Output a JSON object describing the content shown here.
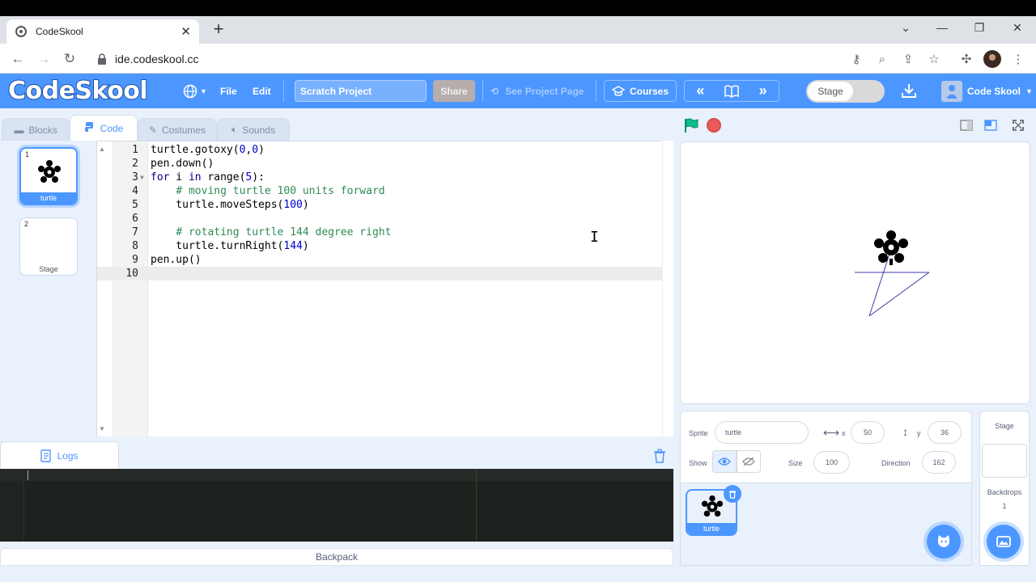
{
  "browser": {
    "tab_title": "CodeSkool",
    "url": "ide.codeskool.cc"
  },
  "menubar": {
    "logo": "CodeSkool",
    "file": "File",
    "edit": "Edit",
    "project_title": "Scratch Project",
    "share": "Share",
    "see_project_page": "See Project Page",
    "courses": "Courses",
    "prev": "«",
    "next": "»",
    "stage_toggle": "Stage",
    "user": "Code Skool"
  },
  "editor_tabs": [
    {
      "label": "Blocks",
      "icon": "blocks-icon"
    },
    {
      "label": "Code",
      "icon": "python-icon"
    },
    {
      "label": "Costumes",
      "icon": "brush-icon"
    },
    {
      "label": "Sounds",
      "icon": "speaker-icon"
    }
  ],
  "sprite_list": [
    {
      "num": "1",
      "label": "turtle"
    },
    {
      "num": "2",
      "label": "Stage"
    }
  ],
  "code_lines": [
    {
      "n": "1",
      "text": "turtle.gotoxy(0,0)"
    },
    {
      "n": "2",
      "text": "pen.down()"
    },
    {
      "n": "3",
      "text": "for i in range(5):"
    },
    {
      "n": "4",
      "text": "    # moving turtle 100 units forward"
    },
    {
      "n": "5",
      "text": "    turtle.moveSteps(100)"
    },
    {
      "n": "6",
      "text": ""
    },
    {
      "n": "7",
      "text": "    # rotating turtle 144 degree right"
    },
    {
      "n": "8",
      "text": "    turtle.turnRight(144)"
    },
    {
      "n": "9",
      "text": "pen.up()"
    },
    {
      "n": "10",
      "text": ""
    }
  ],
  "logs": {
    "tab_label": "Logs",
    "backpack": "Backpack"
  },
  "sprite_info": {
    "sprite_label": "Sprite",
    "sprite_name": "turtle",
    "x_label": "x",
    "x_value": "50",
    "y_label": "y",
    "y_value": "36",
    "show_label": "Show",
    "size_label": "Size",
    "size_value": "100",
    "direction_label": "Direction",
    "direction_value": "162"
  },
  "sprite_pane": {
    "thumb_label": "turtle"
  },
  "stage_target": {
    "title": "Stage",
    "backdrops_label": "Backdrops",
    "backdrops_count": "1"
  },
  "colors": {
    "brand": "#4c97ff",
    "flag": "#0fbd8c",
    "stop": "#ec5959",
    "pen": "#3d3da8"
  }
}
